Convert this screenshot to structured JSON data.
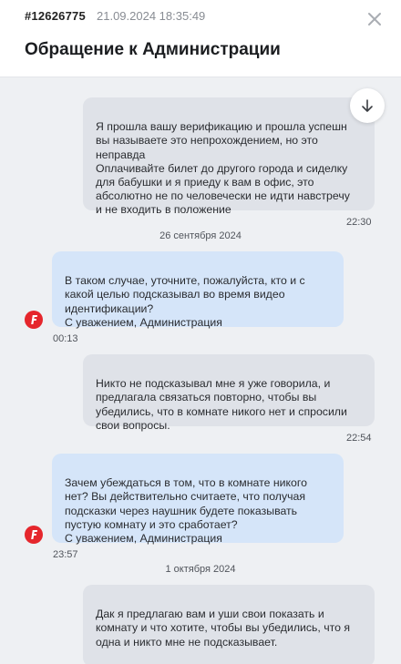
{
  "header": {
    "ticket_id": "#12626775",
    "datetime": "21.09.2024 18:35:49",
    "title": "Обращение к Администрации"
  },
  "messages": [
    {
      "direction": "out",
      "text": "Я прошла вашу верификацию и прошла успешн\nвы называете это непрохождением, но это\nнеправда\nОплачивайте билет до другого города и сиделку\nдля бабушки и я приеду к вам в офис, это\nабсолютно не по человечески не идти навстречу\nи не входить в положение",
      "time": "22:30"
    },
    {
      "direction": "in",
      "text": "В таком случае, уточните, пожалуйста, кто и с\nкакой целью подсказывал во время видео\nидентификации?\nС уважением, Администрация",
      "time": "00:13"
    },
    {
      "direction": "out",
      "text": "Никто не подсказывал мне я уже говорила, и\nпредлагала связаться повторно, чтобы вы\nубедились, что в комнате никого нет и спросили\nсвои вопросы.",
      "time": "22:54"
    },
    {
      "direction": "in",
      "text": "Зачем убеждаться в том, что в комнате никого\nнет? Вы действительно считаете, что получая\nподсказки через наушник будете показывать\nпустую комнату и это сработает?\nС уважением, Администрация",
      "time": "23:57"
    },
    {
      "direction": "out",
      "text": "Дак я предлагаю вам и уши свои показать и\nкомнату и что хотите, чтобы вы убедились, что я\nодна и никто мне не подсказывает.",
      "time": ""
    }
  ],
  "date_separators": [
    "26 сентября 2024",
    "1 октября 2024"
  ],
  "colors": {
    "chat_bg": "#eef0f3",
    "outgoing_bubble": "#dfe2e8",
    "incoming_bubble": "#d5e5f9",
    "avatar_red": "#e5262c"
  },
  "icons": {
    "close": "close-icon",
    "scroll_down": "arrow-down-icon",
    "avatar": "admin-avatar-logo"
  }
}
